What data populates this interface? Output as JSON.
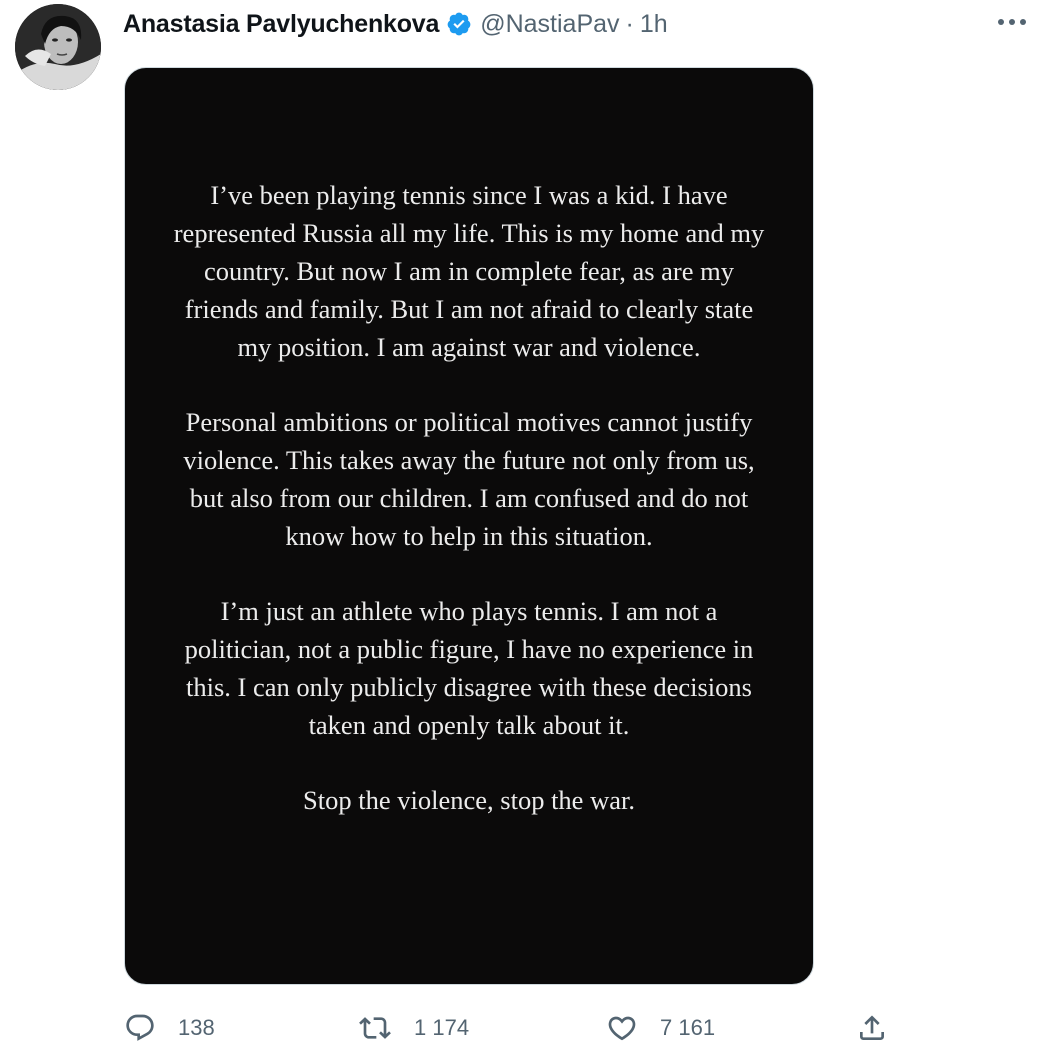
{
  "tweet": {
    "author_name": "Anastasia Pavlyuchenkova",
    "handle": "@NastiaPav",
    "separator": "·",
    "time": "1h",
    "verified_icon": "verified-badge-icon",
    "more_icon": "more-options-icon"
  },
  "media": {
    "paragraphs": [
      "I’ve been playing tennis since I was a kid. I have represented Russia all my life. This is my home and my country. But now I am in complete fear, as are my friends and family. But I am not afraid to clearly state my position. I am against war and violence.",
      "Personal ambitions or political motives cannot justify violence. This takes away the future not only from us, but also from our children. I am confused and do not know how to help in this situation.",
      "I’m just an athlete who plays tennis. I am not a politician, not a public figure, I have no experience in this. I can only publicly disagree with these decisions taken and openly talk about it.",
      "Stop the violence, stop the war."
    ]
  },
  "actions": {
    "reply_count": "138",
    "retweet_count": "1 174",
    "like_count": "7 161",
    "reply_icon": "reply-icon",
    "retweet_icon": "retweet-icon",
    "like_icon": "heart-icon",
    "share_icon": "share-icon"
  },
  "colors": {
    "verified_blue": "#1d9bf0",
    "text_primary": "#0f1419",
    "text_secondary": "#536471",
    "media_background": "#0b0a0a"
  }
}
